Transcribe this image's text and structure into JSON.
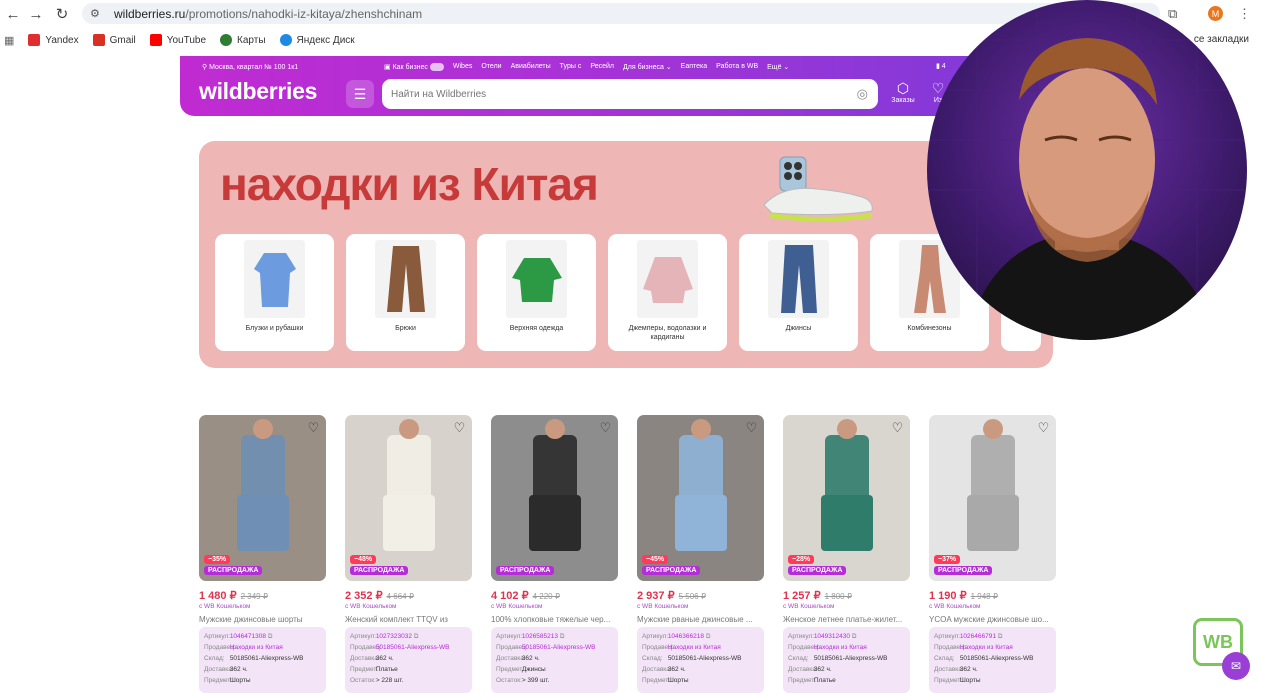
{
  "browser": {
    "url_host": "wildberries.ru",
    "url_path": "/promotions/nahodki-iz-kitaya/zhenshchinam",
    "profile_initial": "M",
    "bookmarks": [
      {
        "label": "Yandex",
        "color": "#e02e2e"
      },
      {
        "label": "Gmail",
        "color": "#d93025"
      },
      {
        "label": "YouTube",
        "color": "#ff0000"
      },
      {
        "label": "Карты",
        "color": "#2e7d32"
      },
      {
        "label": "Яндекс Диск",
        "color": "#1e88e5"
      }
    ],
    "all_bookmarks": "се закладки"
  },
  "header": {
    "location": "Москва, квартал № 100 1к1",
    "business_toggle": "Как бизнес",
    "links": [
      "Wibes",
      "Отели",
      "Авиабилеты",
      "Туры с",
      "Ресейл",
      "Для бизнеса ⌄",
      "Eaптека",
      "Работа в WB",
      "Ещё ⌄"
    ],
    "logo": "wildberries",
    "search_placeholder": "Найти на Wildberries",
    "orders_label": "Заказы",
    "fav_label": "Из",
    "top_right": "4"
  },
  "promo": {
    "title": "находки из Китая",
    "categories": [
      {
        "label": "Блузки и рубашки",
        "color": "#6c9be0"
      },
      {
        "label": "Брюки",
        "color": "#8a5a3c"
      },
      {
        "label": "Верхняя одежда",
        "color": "#2c9a45"
      },
      {
        "label": "Джемперы, водолазки и кардиганы",
        "color": "#e4b4b8"
      },
      {
        "label": "Джинсы",
        "color": "#3f5f93"
      },
      {
        "label": "Комбинезоны",
        "color": "#c98a73"
      }
    ]
  },
  "products": [
    {
      "discount": "−35%",
      "sale": "РАСПРОДАЖА",
      "price": "1 480 ₽",
      "old": "2 349 ₽",
      "wallet": "с WB Кошельком",
      "name": "Мужские джинсовые шорты",
      "article": "1046471308",
      "seller": "Находки из Китая",
      "warehouse": "50185061-Aliexpress-WB",
      "delivery": "362 ч.",
      "subject": "Шорты",
      "stock": "",
      "img_bg": "#9a8f84",
      "img_fg": "#6f8fb4"
    },
    {
      "discount": "−48%",
      "sale": "РАСПРОДАЖА",
      "price": "2 352 ₽",
      "old": "4 664 ₽",
      "wallet": "с WB Кошельком",
      "name": "Женский комплект TTQV из",
      "article": "1027323032",
      "seller": "50185061-Aliexpress-WB",
      "warehouse": "",
      "delivery": "362 ч.",
      "subject": "Платье",
      "stock": "> 228 шт.",
      "img_bg": "#d7d2cb",
      "img_fg": "#f2efe7"
    },
    {
      "discount": "",
      "sale": "РАСПРОДАЖА",
      "price": "4 102 ₽",
      "old": "4 220 ₽",
      "wallet": "с WB Кошельком",
      "name": "100% хлопковые тяжелые чер...",
      "article": "1026585213",
      "seller": "50185061-Aliexpress-WB",
      "warehouse": "",
      "delivery": "362 ч.",
      "subject": "Джинсы",
      "stock": "> 399 шт.",
      "img_bg": "#8d8d8d",
      "img_fg": "#2b2b2b"
    },
    {
      "discount": "−45%",
      "sale": "РАСПРОДАЖА",
      "price": "2 937 ₽",
      "old": "5 506 ₽",
      "wallet": "с WB Кошельком",
      "name": "Мужские рваные джинсовые ...",
      "article": "1046366218",
      "seller": "Находки из Китая",
      "warehouse": "50185061-Aliexpress-WB",
      "delivery": "362 ч.",
      "subject": "Шорты",
      "stock": "",
      "img_bg": "#8a8581",
      "img_fg": "#8fb4d8"
    },
    {
      "discount": "−28%",
      "sale": "РАСПРОДАЖА",
      "price": "1 257 ₽",
      "old": "1 800 ₽",
      "wallet": "с WB Кошельком",
      "name": "Женское летнее платье-жилет...",
      "article": "1049312430",
      "seller": "Находки из Китая",
      "warehouse": "50185061-Aliexpress-WB",
      "delivery": "362 ч.",
      "subject": "Платье",
      "stock": "",
      "img_bg": "#d9d6cf",
      "img_fg": "#2f7c6b"
    },
    {
      "discount": "−37%",
      "sale": "РАСПРОДАЖА",
      "price": "1 190 ₽",
      "old": "1 948 ₽",
      "wallet": "с WB Кошельком",
      "name": "YCOA мужские джинсовые шо...",
      "article": "1026466791",
      "seller": "Находки из Китая",
      "warehouse": "50185061-Aliexpress-WB",
      "delivery": "362 ч.",
      "subject": "Шорты",
      "stock": "",
      "img_bg": "#e4e4e4",
      "img_fg": "#a9a9a9"
    }
  ],
  "info_labels": {
    "article": "Артикул:",
    "seller": "Продавец:",
    "warehouse": "Склад:",
    "delivery": "Доставка:",
    "subject": "Предмет:",
    "stock": "Остаток:"
  },
  "badge": "WB"
}
